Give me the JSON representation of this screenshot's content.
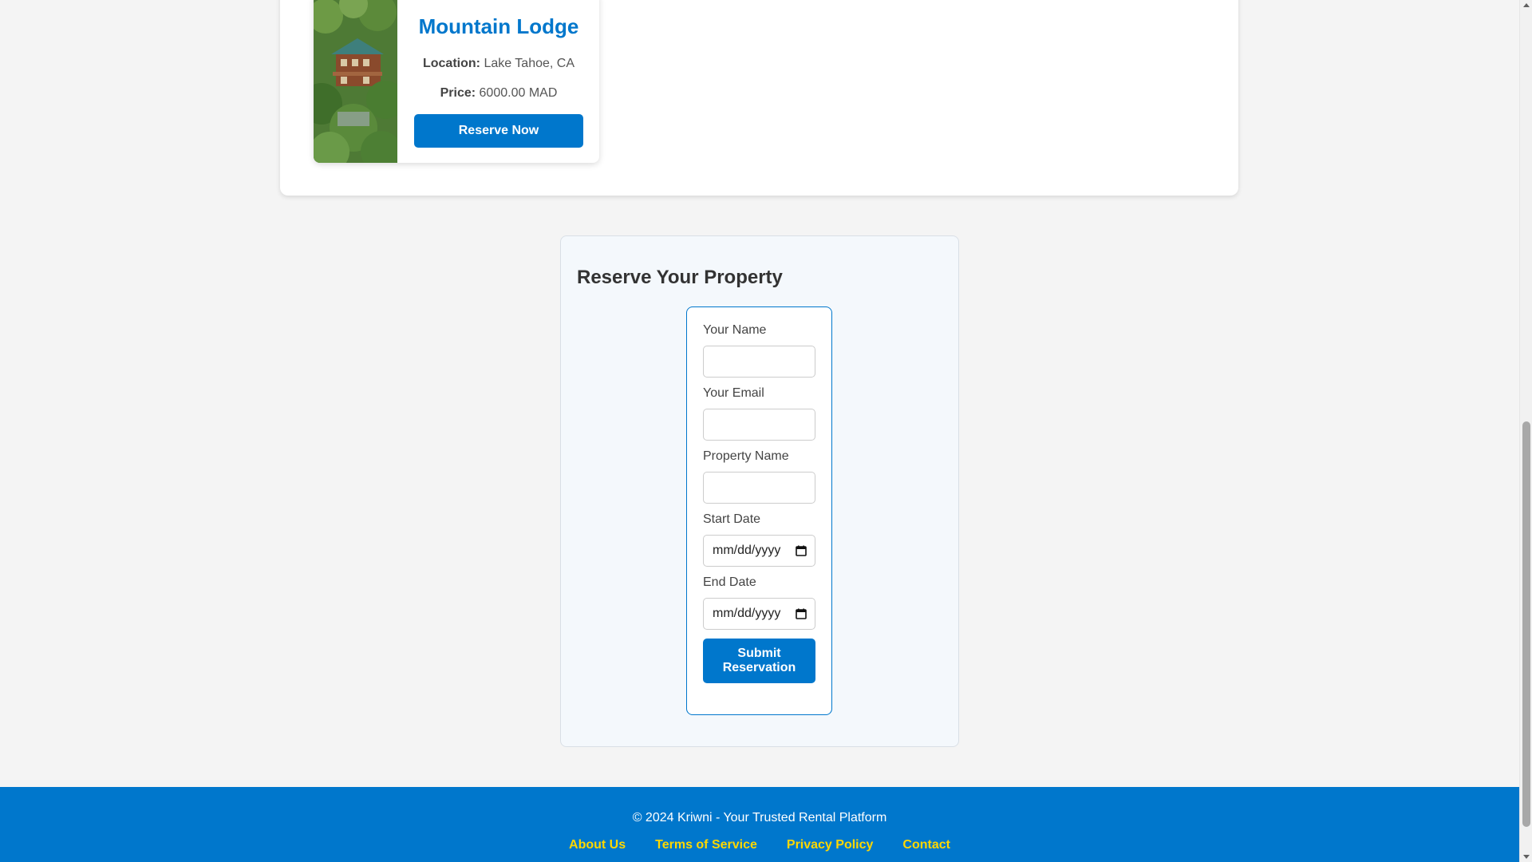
{
  "property": {
    "title": "Mountain Lodge",
    "location_label": "Location:",
    "location_value": "Lake Tahoe, CA",
    "price_label": "Price:",
    "price_value": "6000.00 MAD",
    "reserve_button": "Reserve Now"
  },
  "reservation": {
    "heading": "Reserve Your Property",
    "name_label": "Your Name",
    "email_label": "Your Email",
    "property_label": "Property Name",
    "start_label": "Start Date",
    "start_placeholder": "mm/dd/yyyy",
    "end_label": "End Date",
    "end_placeholder": "mm/dd/yyyy",
    "submit_line1": "Submit",
    "submit_line2": "Reservation"
  },
  "footer": {
    "copyright": "© 2024 Kriwni - Your Trusted Rental Platform",
    "links": [
      "About Us",
      "Terms of Service",
      "Privacy Policy",
      "Contact"
    ]
  },
  "colors": {
    "primary": "#0077cc",
    "footer_link": "#ffd700"
  },
  "icons": {
    "date": "calendar-icon",
    "property_image": "mountain-lodge-photo"
  }
}
